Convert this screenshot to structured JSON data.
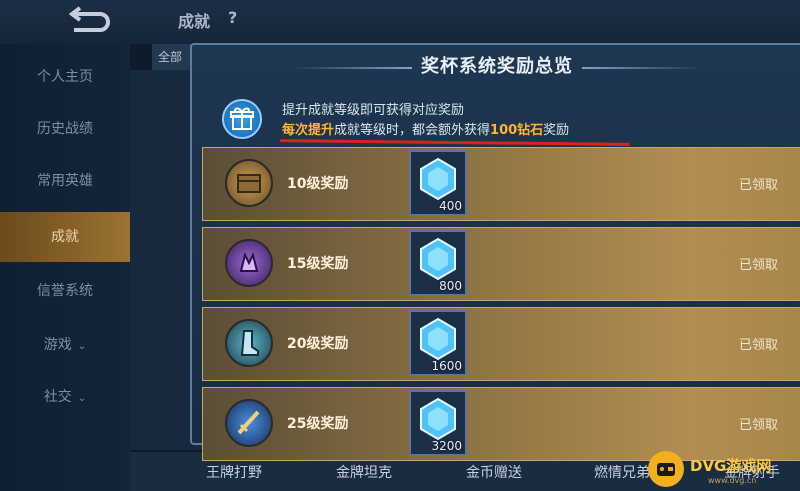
{
  "header": {
    "title": "成就",
    "help": "?",
    "tab": "全部"
  },
  "sidebar": {
    "items": [
      {
        "label": "个人主页",
        "chevron": ""
      },
      {
        "label": "历史战绩",
        "chevron": ""
      },
      {
        "label": "常用英雄",
        "chevron": ""
      },
      {
        "label": "成就",
        "chevron": ""
      },
      {
        "label": "信誉系统",
        "chevron": ""
      },
      {
        "label": "游戏",
        "chevron": "⌄"
      },
      {
        "label": "社交",
        "chevron": "⌄"
      }
    ]
  },
  "bottom_tabs": [
    "王牌打野",
    "金牌坦克",
    "金币赠送",
    "燃情兄弟",
    "金牌射手"
  ],
  "modal": {
    "title": "奖杯系统奖励总览",
    "notice": {
      "line1": "提升成就等级即可获得对应奖励",
      "line2_a": "每次提升",
      "line2_b": "成就等级时，都会额外获得",
      "line2_c": "100钻石",
      "line2_d": "奖励"
    },
    "rows": [
      {
        "label": "10级奖励",
        "amount": "400",
        "status": "已领取"
      },
      {
        "label": "15级奖励",
        "amount": "800",
        "status": "已领取"
      },
      {
        "label": "20级奖励",
        "amount": "1600",
        "status": "已领取"
      },
      {
        "label": "25级奖励",
        "amount": "3200",
        "status": "已领取"
      }
    ]
  },
  "watermark": {
    "name": "DVG游戏网",
    "sub": "www.dvg.cn"
  },
  "colors": {
    "highlight": "#ffb52e",
    "underline": "#d9231d",
    "row_gold": "#b28d52"
  }
}
